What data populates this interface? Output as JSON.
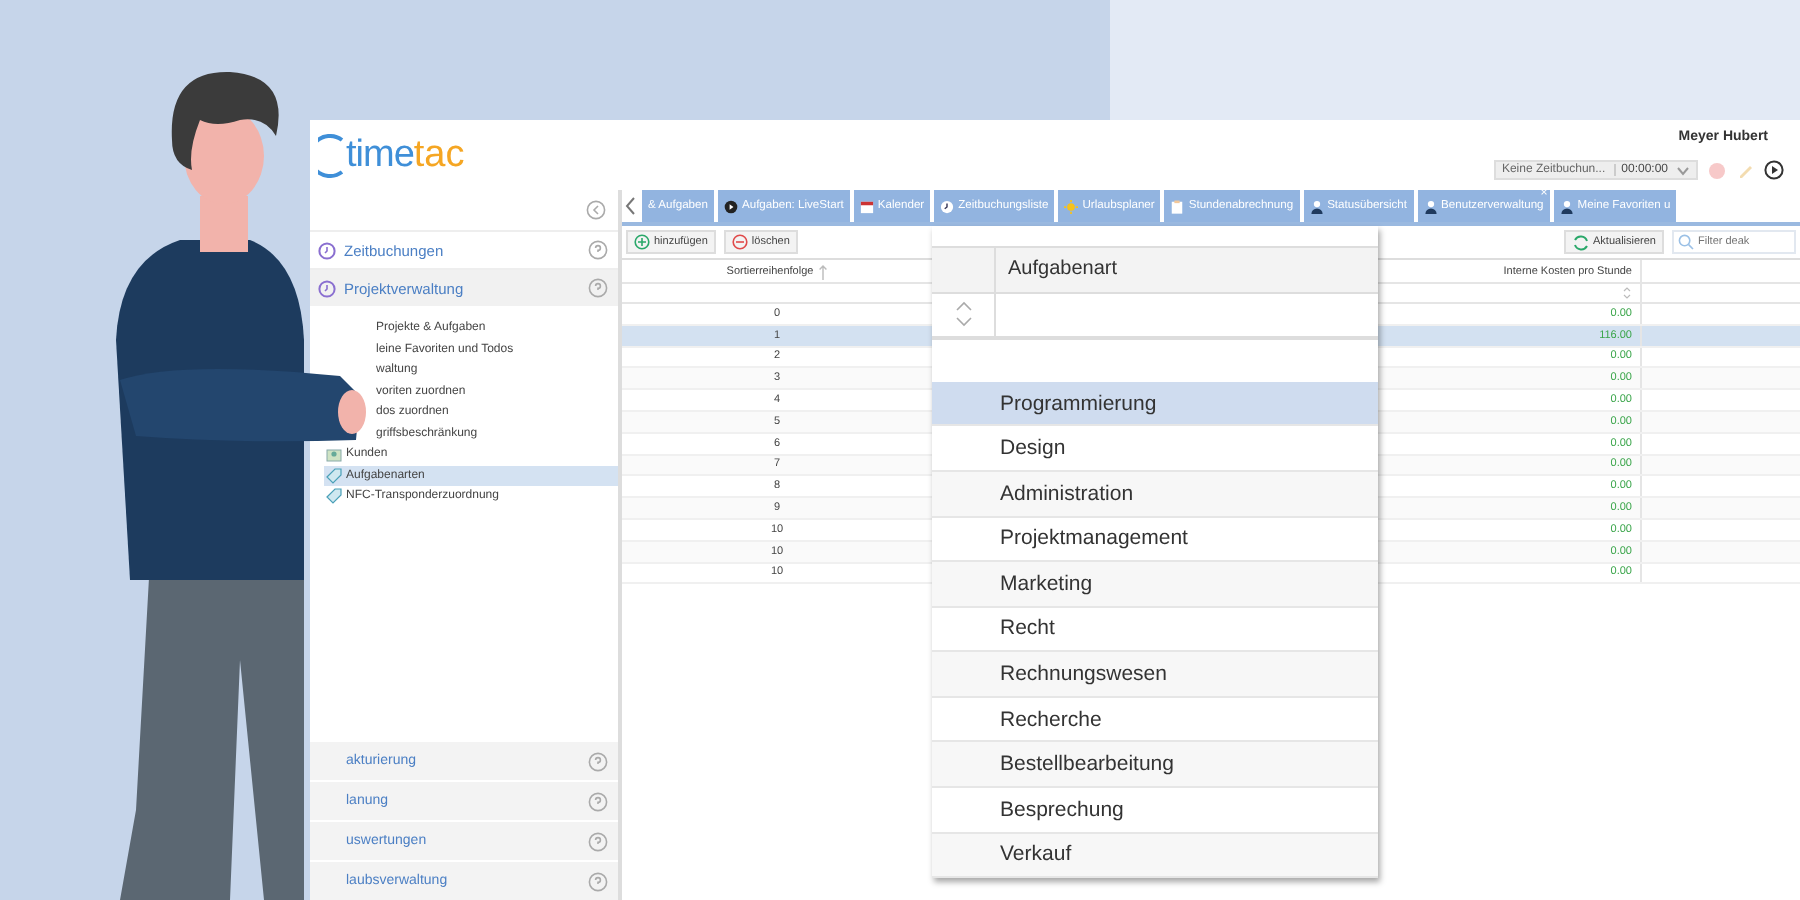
{
  "header": {
    "logo_main": "time",
    "logo_accent": "tac",
    "user_name": "Meyer Hubert",
    "timer": {
      "task": "Keine Zeitbuchun...",
      "time": "00:00:00"
    }
  },
  "sidebar": {
    "sections": [
      {
        "label": "Zeitbuchungen",
        "expanded": false
      },
      {
        "label": "Projektverwaltung",
        "expanded": true
      }
    ],
    "items": [
      {
        "label": "Projekte & Aufgaben",
        "kind": "plain",
        "selected": false
      },
      {
        "label": "leine Favoriten und Todos",
        "kind": "plain",
        "selected": false
      },
      {
        "label": "waltung",
        "kind": "plain",
        "selected": false
      },
      {
        "label": "voriten zuordnen",
        "kind": "plain",
        "selected": false
      },
      {
        "label": "dos zuordnen",
        "kind": "plain",
        "selected": false
      },
      {
        "label": "griffsbeschränkung",
        "kind": "plain",
        "selected": false
      },
      {
        "label": "Kunden",
        "kind": "customers",
        "selected": false
      },
      {
        "label": "Aufgabenarten",
        "kind": "tag",
        "selected": true
      },
      {
        "label": "NFC-Transponderzuordnung",
        "kind": "tag",
        "selected": false
      }
    ],
    "bottom_sections": [
      "akturierung",
      "lanung",
      "uswertungen",
      "laubsverwaltung"
    ]
  },
  "tabs": [
    {
      "label": "& Aufgaben"
    },
    {
      "label": "Aufgaben: LiveStart"
    },
    {
      "label": "Kalender"
    },
    {
      "label": "Zeitbuchungsliste"
    },
    {
      "label": "Urlaubsplaner"
    },
    {
      "label": "Stundenabrechnung"
    },
    {
      "label": "Statusübersicht"
    },
    {
      "label": "Benutzerverwaltung",
      "close": "×"
    },
    {
      "label": "Meine Favoriten u"
    }
  ],
  "toolbar": {
    "add": "hinzufügen",
    "delete": "löschen",
    "refresh": "Aktualisieren",
    "filter_placeholder": "Filter deak"
  },
  "grid": {
    "columns": [
      "Sortierreihenfolge",
      "Interne Kosten pro Stunde"
    ],
    "rows": [
      {
        "order": "0",
        "cost": "0.00",
        "selected": false
      },
      {
        "order": "1",
        "cost": "116.00",
        "selected": true
      },
      {
        "order": "2",
        "cost": "0.00",
        "selected": false
      },
      {
        "order": "3",
        "cost": "0.00",
        "selected": false
      },
      {
        "order": "4",
        "cost": "0.00",
        "selected": false
      },
      {
        "order": "5",
        "cost": "0.00",
        "selected": false
      },
      {
        "order": "6",
        "cost": "0.00",
        "selected": false
      },
      {
        "order": "7",
        "cost": "0.00",
        "selected": false
      },
      {
        "order": "8",
        "cost": "0.00",
        "selected": false
      },
      {
        "order": "9",
        "cost": "0.00",
        "selected": false
      },
      {
        "order": "10",
        "cost": "0.00",
        "selected": false
      },
      {
        "order": "10",
        "cost": "0.00",
        "selected": false
      },
      {
        "order": "10",
        "cost": "0.00",
        "selected": false
      }
    ]
  },
  "popup": {
    "header": "Aufgabenart",
    "options": [
      {
        "label": "Programmierung",
        "selected": true
      },
      {
        "label": "Design",
        "selected": false
      },
      {
        "label": "Administration",
        "selected": false
      },
      {
        "label": "Projektmanagement",
        "selected": false
      },
      {
        "label": "Marketing",
        "selected": false
      },
      {
        "label": "Recht",
        "selected": false
      },
      {
        "label": "Rechnungswesen",
        "selected": false
      },
      {
        "label": "Recherche",
        "selected": false
      },
      {
        "label": "Bestellbearbeitung",
        "selected": false
      },
      {
        "label": "Besprechung",
        "selected": false
      },
      {
        "label": "Verkauf",
        "selected": false
      }
    ]
  }
}
